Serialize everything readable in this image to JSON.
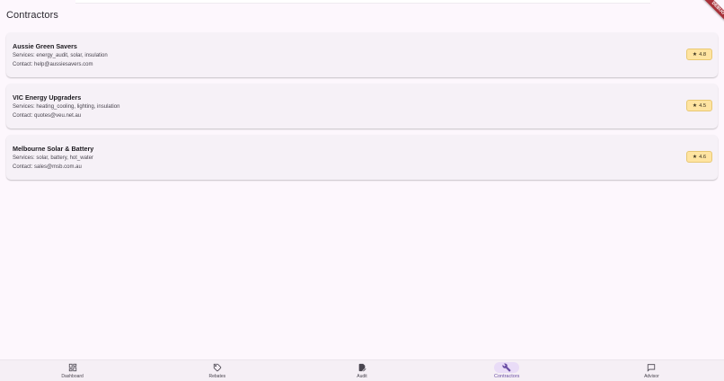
{
  "app_bar": {
    "title": "Contractors",
    "debug_banner": "DEBUG"
  },
  "contractors": [
    {
      "name": "Aussie Green Savers",
      "services": "Services: energy_audit, solar, insulation",
      "contact": "Contact: help@aussiesavers.com",
      "rating": "4.8"
    },
    {
      "name": "VIC Energy Upgraders",
      "services": "Services: heating_cooling, lighting, insulation",
      "contact": "Contact: quotes@veu.net.au",
      "rating": "4.5"
    },
    {
      "name": "Melbourne Solar & Battery",
      "services": "Services: solar, battery, hot_water",
      "contact": "Contact: sales@msb.com.au",
      "rating": "4.6"
    }
  ],
  "rating_star": "★",
  "nav": {
    "items": [
      {
        "label": "Dashboard",
        "icon": "dashboard-icon"
      },
      {
        "label": "Rebates",
        "icon": "tag-icon"
      },
      {
        "label": "Audit",
        "icon": "document-edit-icon"
      },
      {
        "label": "Contractors",
        "icon": "wrench-icon",
        "active": true
      },
      {
        "label": "Advisor",
        "icon": "chat-icon"
      }
    ]
  },
  "colors": {
    "background": "#fdf7fd",
    "card": "#f6f1f7",
    "rating_badge": "#ffe4a1",
    "active_nav": "#6b4fa5",
    "active_pill": "#e9dcf7",
    "debug_ribbon": "#a8323a"
  }
}
